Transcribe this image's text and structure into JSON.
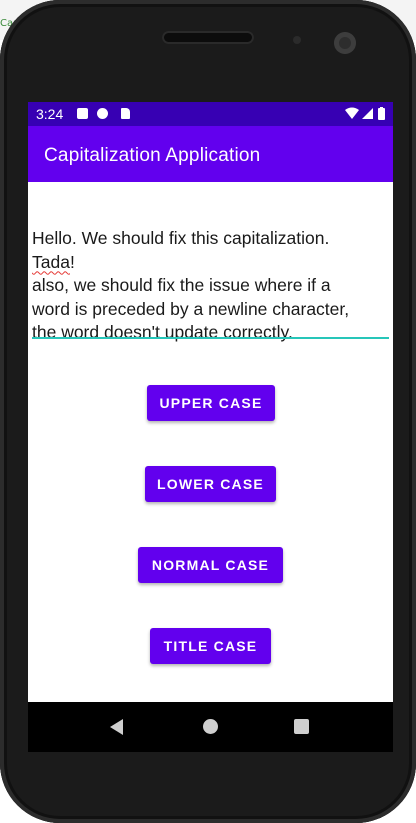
{
  "host": {
    "title_fragment": "Cap"
  },
  "status_bar": {
    "time": "3:24",
    "icons": [
      "notification-a-icon",
      "notification-p-icon",
      "sd-card-icon",
      "wifi-icon",
      "signal-icon",
      "battery-icon"
    ]
  },
  "app_bar": {
    "title": "Capitalization Application"
  },
  "editor": {
    "lines": [
      "Hello. We should fix this capitalization.",
      "!",
      "also, we should fix the issue where if a",
      "word is preceded by a newline character,",
      "the word doesn't update correctly."
    ],
    "misspelled_word": "Tada",
    "underline_color": "#26c6b9",
    "misspell_color": "#e53935"
  },
  "buttons": {
    "upper": "UPPER CASE",
    "lower": "LOWER CASE",
    "normal": "NORMAL CASE",
    "title": "TITLE CASE"
  },
  "nav_bar": {
    "icons": [
      "back-icon",
      "home-icon",
      "recents-icon"
    ]
  },
  "colors": {
    "primary": "#6200ee",
    "primary_dark": "#3700b3",
    "accent": "#26c6b9"
  }
}
